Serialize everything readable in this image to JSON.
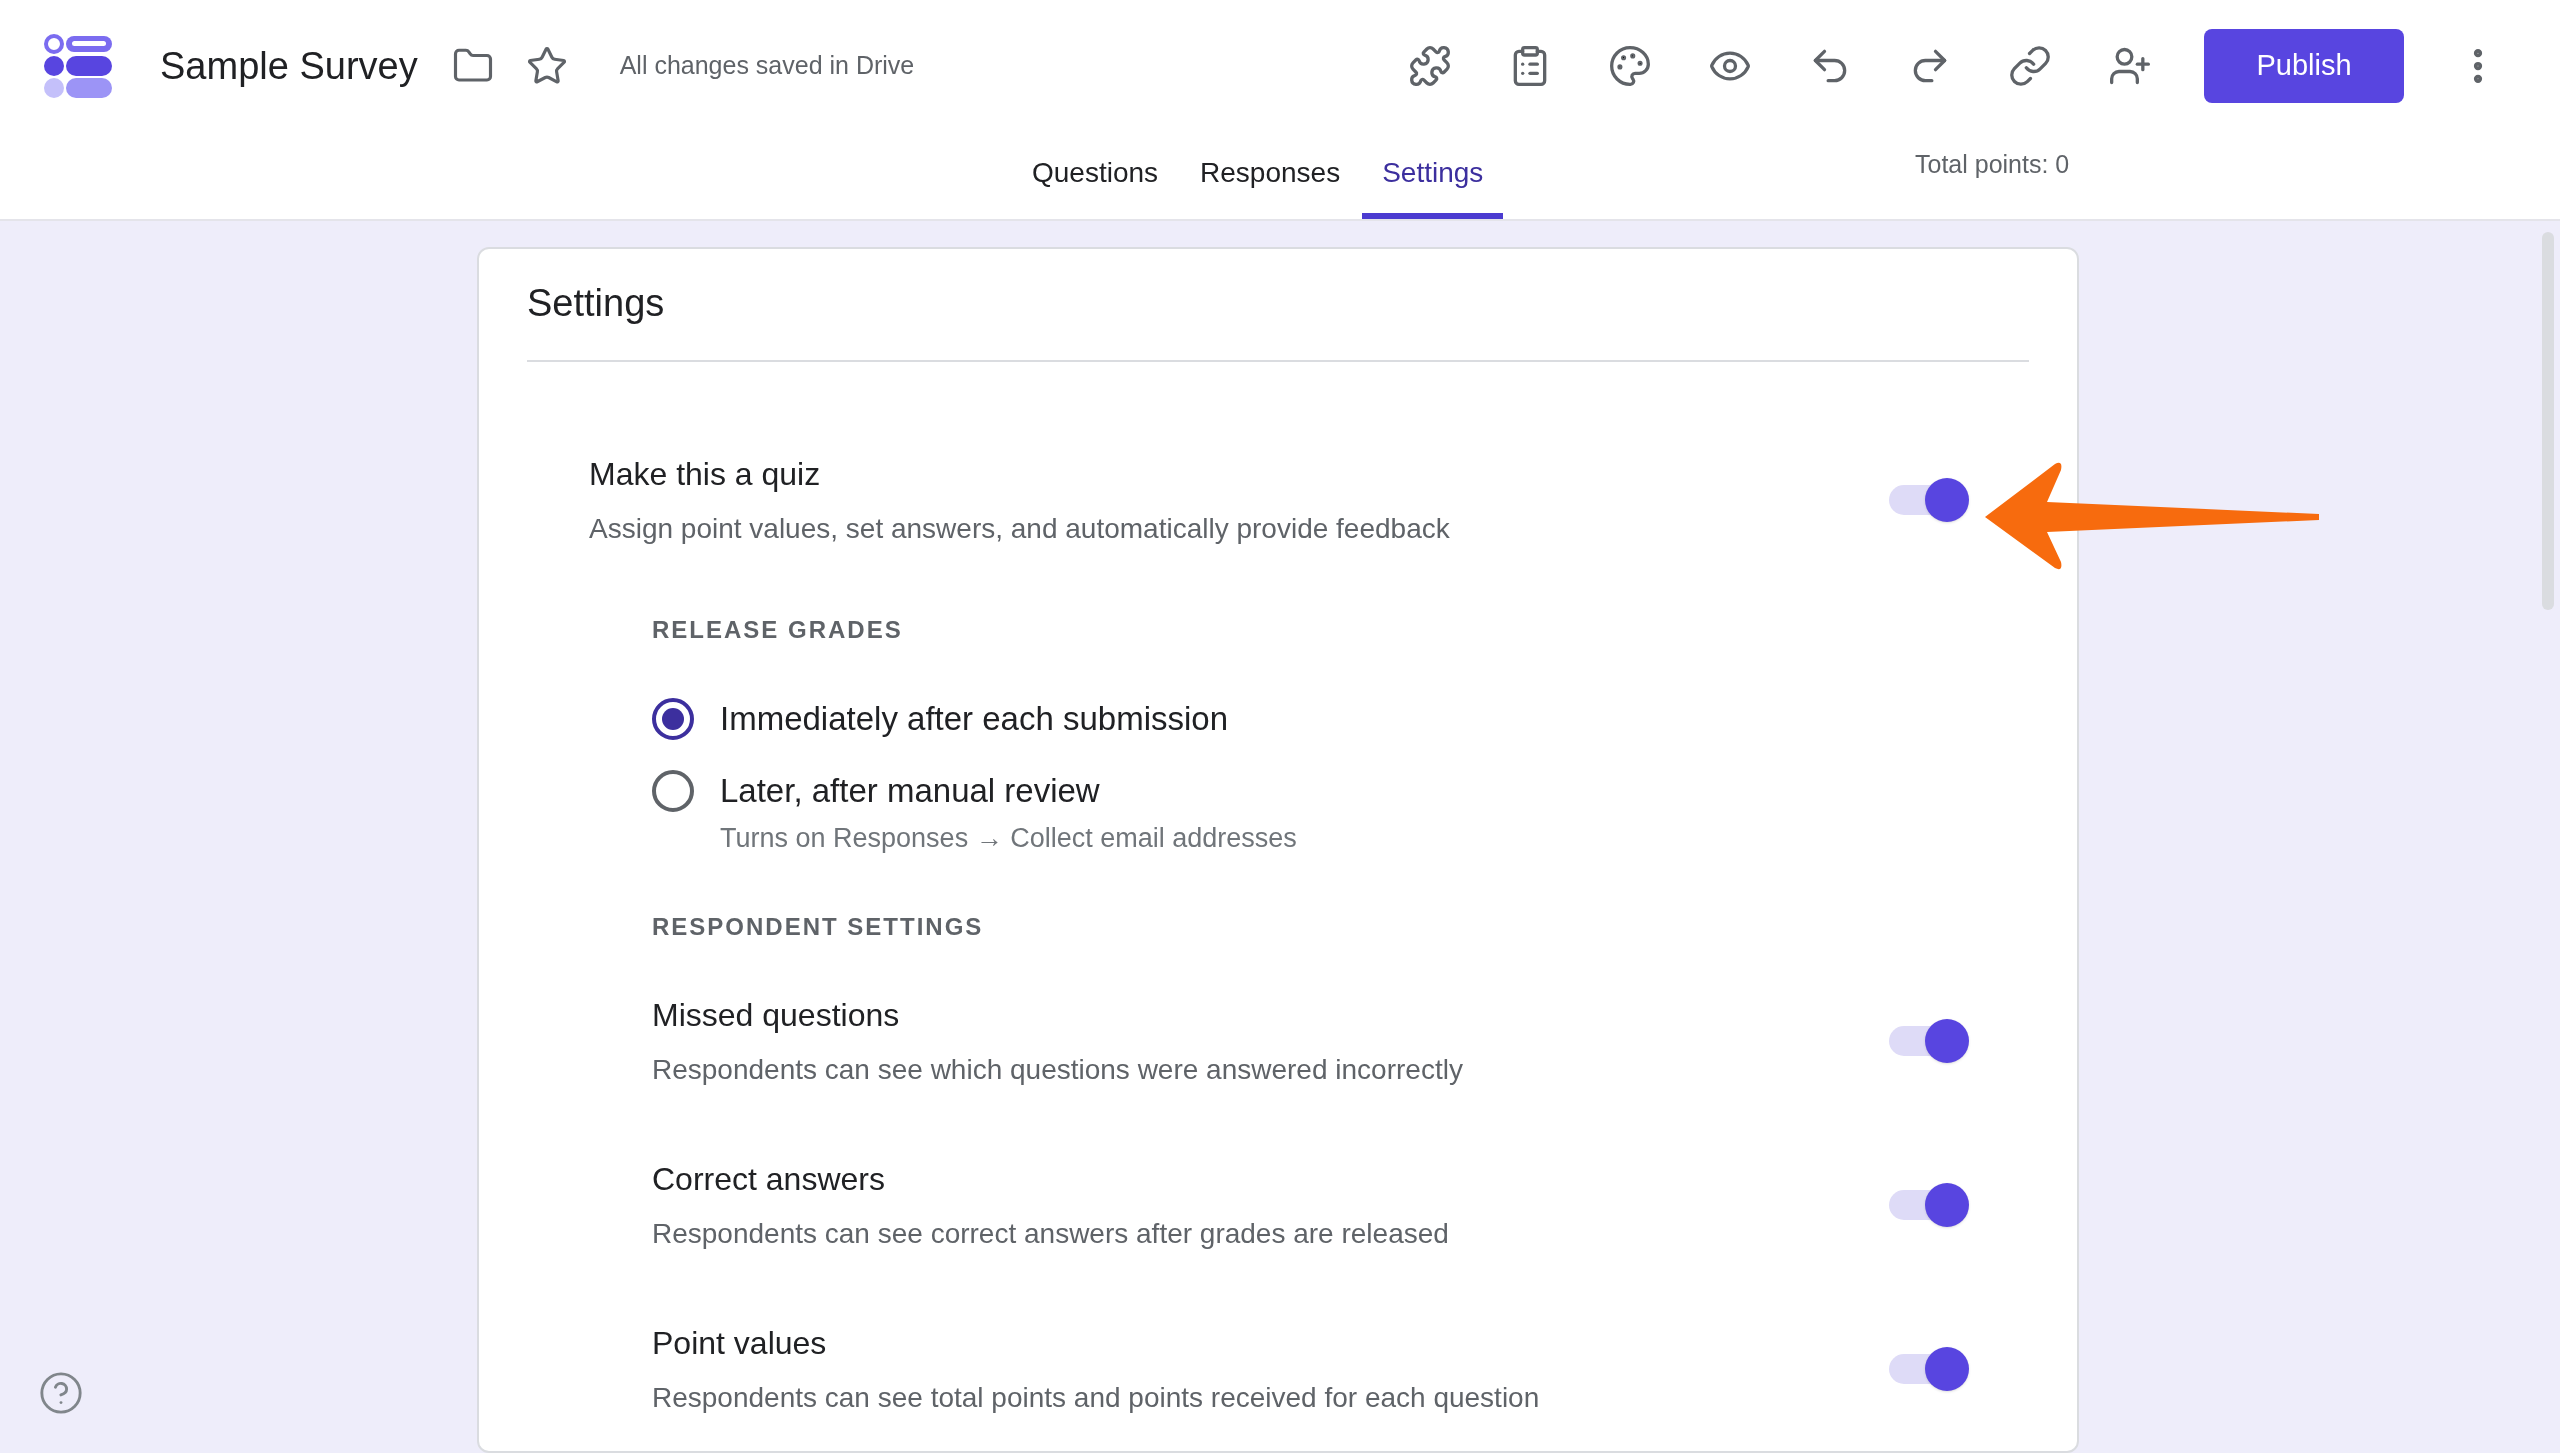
{
  "header": {
    "title": "Sample Survey",
    "save_status": "All changes saved in Drive",
    "publish_button": "Publish"
  },
  "tabs": [
    {
      "label": "Questions",
      "selected": false
    },
    {
      "label": "Responses",
      "selected": false
    },
    {
      "label": "Settings",
      "selected": true
    }
  ],
  "total_points": "Total points: 0",
  "settings": {
    "title": "Settings",
    "quiz": {
      "title": "Make this a quiz",
      "description": "Assign point values, set answers, and automatically provide feedback",
      "on": true
    },
    "release_grades": {
      "heading": "RELEASE GRADES",
      "options": [
        {
          "label": "Immediately after each submission",
          "selected": true
        },
        {
          "label": "Later, after manual review",
          "sublabel": "Turns on Responses → Collect email addresses",
          "selected": false
        }
      ]
    },
    "respondent_settings": {
      "heading": "RESPONDENT SETTINGS",
      "items": [
        {
          "title": "Missed questions",
          "description": "Respondents can see which questions were answered incorrectly",
          "on": true
        },
        {
          "title": "Correct answers",
          "description": "Respondents can see correct answers after grades are released",
          "on": true
        },
        {
          "title": "Point values",
          "description": "Respondents can see total points and points received for each question",
          "on": true
        }
      ]
    }
  }
}
